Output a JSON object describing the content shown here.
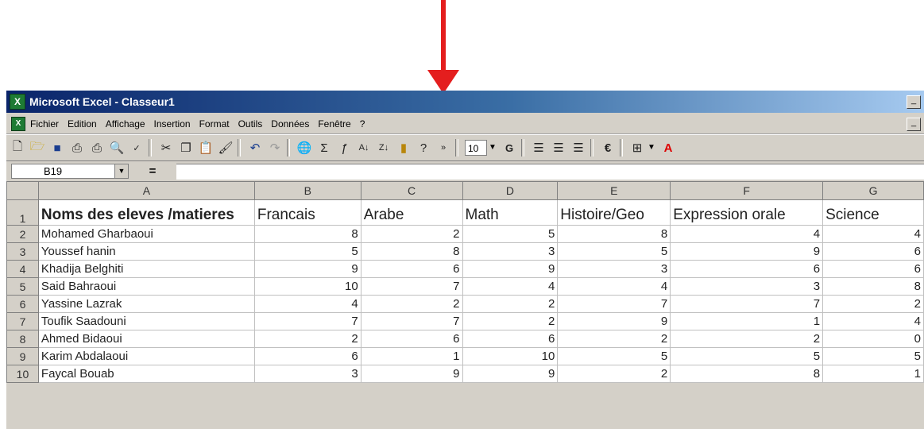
{
  "window": {
    "title": "Microsoft Excel - Classeur1",
    "app_icon": "excel-icon"
  },
  "menu": [
    "Fichier",
    "Edition",
    "Affichage",
    "Insertion",
    "Format",
    "Outils",
    "Données",
    "Fenêtre",
    "?"
  ],
  "toolbar": {
    "font_size": "10",
    "bold_label": "G",
    "currency_label": "€"
  },
  "formula_bar": {
    "name_box": "B19",
    "equals": "="
  },
  "columns": [
    "A",
    "B",
    "C",
    "D",
    "E",
    "F",
    "G"
  ],
  "header_row": {
    "number": "1",
    "cells": [
      "Noms des eleves /matieres",
      "Francais",
      "Arabe",
      "Math",
      "Histoire/Geo",
      "Expression orale",
      "Science"
    ]
  },
  "rows": [
    {
      "number": "2",
      "name": " Mohamed Gharbaoui",
      "values": [
        "8",
        "2",
        "5",
        "8",
        "4",
        "4"
      ]
    },
    {
      "number": "3",
      "name": "Youssef hanin",
      "values": [
        "5",
        "8",
        "3",
        "5",
        "9",
        "6"
      ]
    },
    {
      "number": "4",
      "name": "Khadija Belghiti",
      "values": [
        "9",
        "6",
        "9",
        "3",
        "6",
        "6"
      ]
    },
    {
      "number": "5",
      "name": "Said Bahraoui",
      "values": [
        "10",
        "7",
        "4",
        "4",
        "3",
        "8"
      ]
    },
    {
      "number": "6",
      "name": "Yassine Lazrak",
      "values": [
        "4",
        "2",
        "2",
        "7",
        "7",
        "2"
      ]
    },
    {
      "number": "7",
      "name": "Toufik Saadouni",
      "values": [
        "7",
        "7",
        "2",
        "9",
        "1",
        "4"
      ]
    },
    {
      "number": "8",
      "name": "Ahmed Bidaoui",
      "values": [
        "2",
        "6",
        "6",
        "2",
        "2",
        "0"
      ]
    },
    {
      "number": "9",
      "name": "Karim Abdalaoui",
      "values": [
        "6",
        "1",
        "10",
        "5",
        "5",
        "5"
      ]
    },
    {
      "number": "10",
      "name": "Faycal Bouab",
      "values": [
        "3",
        "9",
        "9",
        "2",
        "8",
        "1"
      ]
    }
  ],
  "colors": {
    "arrow": "#e41e1e",
    "titlebar_start": "#0a246a",
    "titlebar_end": "#a6caf0",
    "chrome": "#d4d0c8"
  }
}
